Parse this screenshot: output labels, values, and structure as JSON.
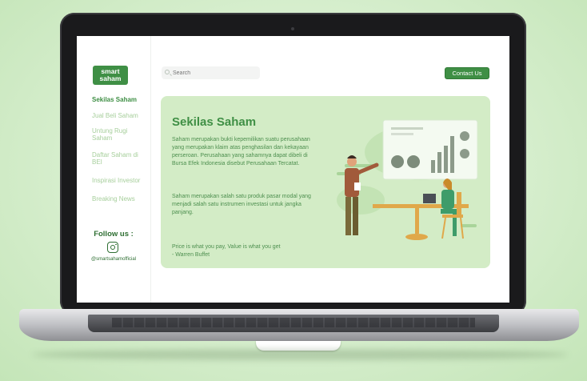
{
  "sidebar": {
    "logo_line1": "smart",
    "logo_line2": "saham",
    "items": [
      {
        "label": "Sekilas Saham",
        "active": true
      },
      {
        "label": "Jual Beli Saham",
        "active": false
      },
      {
        "label": "Untung Rugi Saham",
        "active": false
      },
      {
        "label": "Daftar Saham di BEI",
        "active": false
      },
      {
        "label": "Inspirasi Investor",
        "active": false
      },
      {
        "label": "Breaking News",
        "active": false
      }
    ],
    "follow_label": "Follow us :",
    "instagram_handle": "@smartsahamofficial"
  },
  "header": {
    "search_placeholder": "Search",
    "contact_label": "Contact Us"
  },
  "hero": {
    "title": "Sekilas Saham",
    "paragraph1": "Saham merupakan bukti kepemilikan suatu perusahaan yang merupakan klaim atas penghasilan dan kekayaan perseroan. Perusahaan yang sahamnya dapat dibeli di Bursa Efek Indonesia disebut Perusahaan Tercatat.",
    "paragraph2": "Saham merupakan salah satu produk pasar modal yang menjadi salah satu instrumen investasi untuk jangka panjang.",
    "quote_line1": "Price is what you pay, Value is what you get",
    "quote_line2": "- Warren Buffet"
  },
  "colors": {
    "brand_green": "#3f8f45",
    "hero_bg": "#d3ecc6",
    "nav_inactive": "#a7cf9c",
    "page_bg": "#d6eecd"
  },
  "icons": [
    "search-icon",
    "instagram-icon",
    "presentation-illustration"
  ]
}
